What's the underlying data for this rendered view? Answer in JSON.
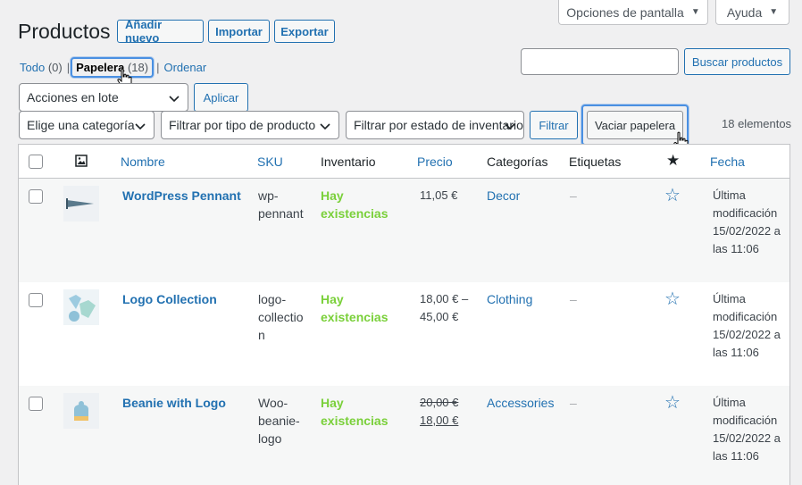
{
  "screen_options": {
    "label": "Opciones de pantalla"
  },
  "help": {
    "label": "Ayuda"
  },
  "page_title": "Productos",
  "actions": {
    "add_new": "Añadir nuevo",
    "import": "Importar",
    "export": "Exportar"
  },
  "views": [
    {
      "label": "Todo",
      "count": "(0)"
    },
    {
      "label": "Papelera",
      "count": "(18)"
    },
    {
      "label": "Ordenar",
      "count": ""
    }
  ],
  "search": {
    "button": "Buscar productos",
    "value": ""
  },
  "bulk": {
    "select": "Acciones en lote",
    "apply": "Aplicar"
  },
  "filters": {
    "category": "Elige una categoría",
    "product_type": "Filtrar por tipo de producto",
    "stock_status": "Filtrar por estado de inventario",
    "filter_button": "Filtrar",
    "empty_trash": "Vaciar papelera"
  },
  "items_count": "18 elementos",
  "columns": {
    "name": "Nombre",
    "sku": "SKU",
    "stock": "Inventario",
    "price": "Precio",
    "categories": "Categorías",
    "tags": "Etiquetas",
    "date": "Fecha"
  },
  "products": [
    {
      "name": "WordPress Pennant",
      "sku": [
        "wp-",
        "pennant"
      ],
      "stock": [
        "Hay",
        "existencias"
      ],
      "price": [
        "11,05 €"
      ],
      "category": "Decor",
      "tags": "–",
      "date": [
        "Última",
        "modificación",
        "15/02/2022 a",
        "las 11:06"
      ]
    },
    {
      "name": "Logo Collection",
      "sku": [
        "logo-",
        "collectio",
        "n"
      ],
      "stock": [
        "Hay",
        "existencias"
      ],
      "price": [
        "18,00 € –",
        "45,00 €"
      ],
      "category": "Clothing",
      "tags": "–",
      "date": [
        "Última",
        "modificación",
        "15/02/2022 a",
        "las 11:06"
      ]
    },
    {
      "name": "Beanie with Logo",
      "sku": [
        "Woo-",
        "beanie-",
        "logo"
      ],
      "stock": [
        "Hay",
        "existencias"
      ],
      "price_old": "20,00 €",
      "price_new": "18,00 €",
      "category": "Accessories",
      "tags": "–",
      "date": [
        "Última",
        "modificación",
        "15/02/2022 a",
        "las 11:06"
      ]
    }
  ],
  "colors": {
    "link": "#2271b1",
    "in_stock": "#7ad03a",
    "highlight": "#4a90e2"
  }
}
